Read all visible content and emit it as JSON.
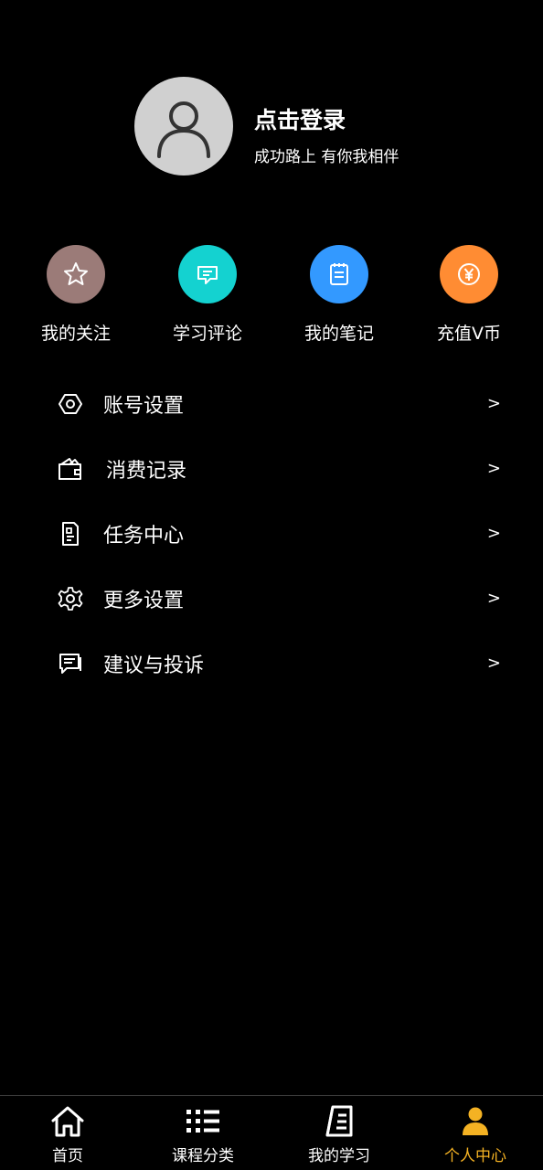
{
  "profile": {
    "avatar_icon": "user-placeholder-icon",
    "title": "点击登录",
    "subtitle": "成功路上 有你我相伴"
  },
  "quick_actions": [
    {
      "label": "我的关注",
      "icon": "star-icon",
      "color": "#9b7b78"
    },
    {
      "label": "学习评论",
      "icon": "comment-icon",
      "color": "#14d2d0"
    },
    {
      "label": "我的笔记",
      "icon": "notebook-icon",
      "color": "#3399ff"
    },
    {
      "label": "充值V币",
      "icon": "yen-coin-icon",
      "color": "#ff8c33"
    }
  ],
  "menu": [
    {
      "label": "账号设置",
      "icon": "hexagon-settings-icon",
      "arrow": ">"
    },
    {
      "label": "消费记录",
      "icon": "wallet-icon",
      "arrow": ">"
    },
    {
      "label": "任务中心",
      "icon": "task-document-icon",
      "arrow": ">"
    },
    {
      "label": "更多设置",
      "icon": "gear-icon",
      "arrow": ">"
    },
    {
      "label": "建议与投诉",
      "icon": "feedback-icon",
      "arrow": ">"
    }
  ],
  "tabbar": {
    "active_color": "#f4b223",
    "tabs": [
      {
        "label": "首页",
        "icon": "home-icon",
        "active": false
      },
      {
        "label": "课程分类",
        "icon": "list-icon",
        "active": false
      },
      {
        "label": "我的学习",
        "icon": "study-notebook-icon",
        "active": false
      },
      {
        "label": "个人中心",
        "icon": "person-icon",
        "active": true
      }
    ]
  }
}
